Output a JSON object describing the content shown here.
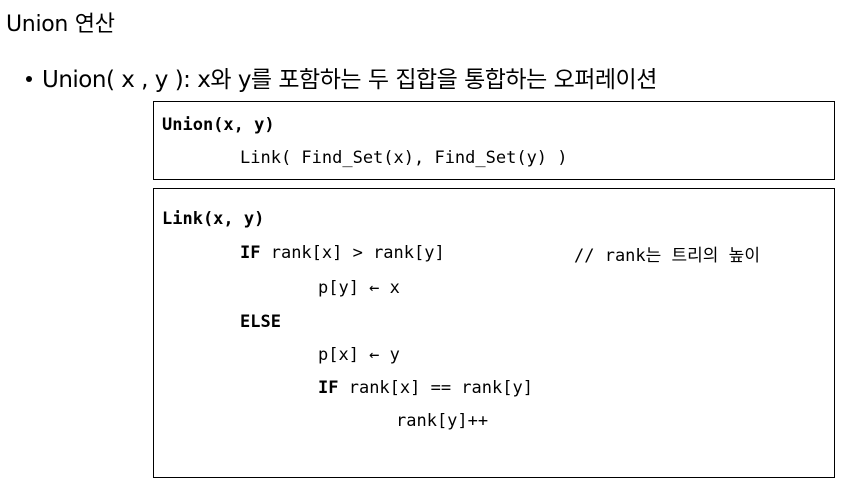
{
  "slide": {
    "title": "Union 연산",
    "bullet": "Union( x , y ): x와 y를 포함하는 두 집합을 통합하는 오퍼레이션"
  },
  "union_box": {
    "header": "Union(x, y)",
    "body": "Link( Find_Set(x), Find_Set(y) )"
  },
  "link_box": {
    "header": "Link(x, y)",
    "if_keyword": "IF",
    "if_condition": " rank[x] > rank[y]",
    "comment": "// rank는 트리의 높이",
    "assign_py": "p[y] ← x",
    "else_keyword": "ELSE",
    "assign_px": "p[x] ← y",
    "if2_keyword": "IF",
    "if2_condition": " rank[x] == rank[y]",
    "increment": "rank[y]++"
  }
}
